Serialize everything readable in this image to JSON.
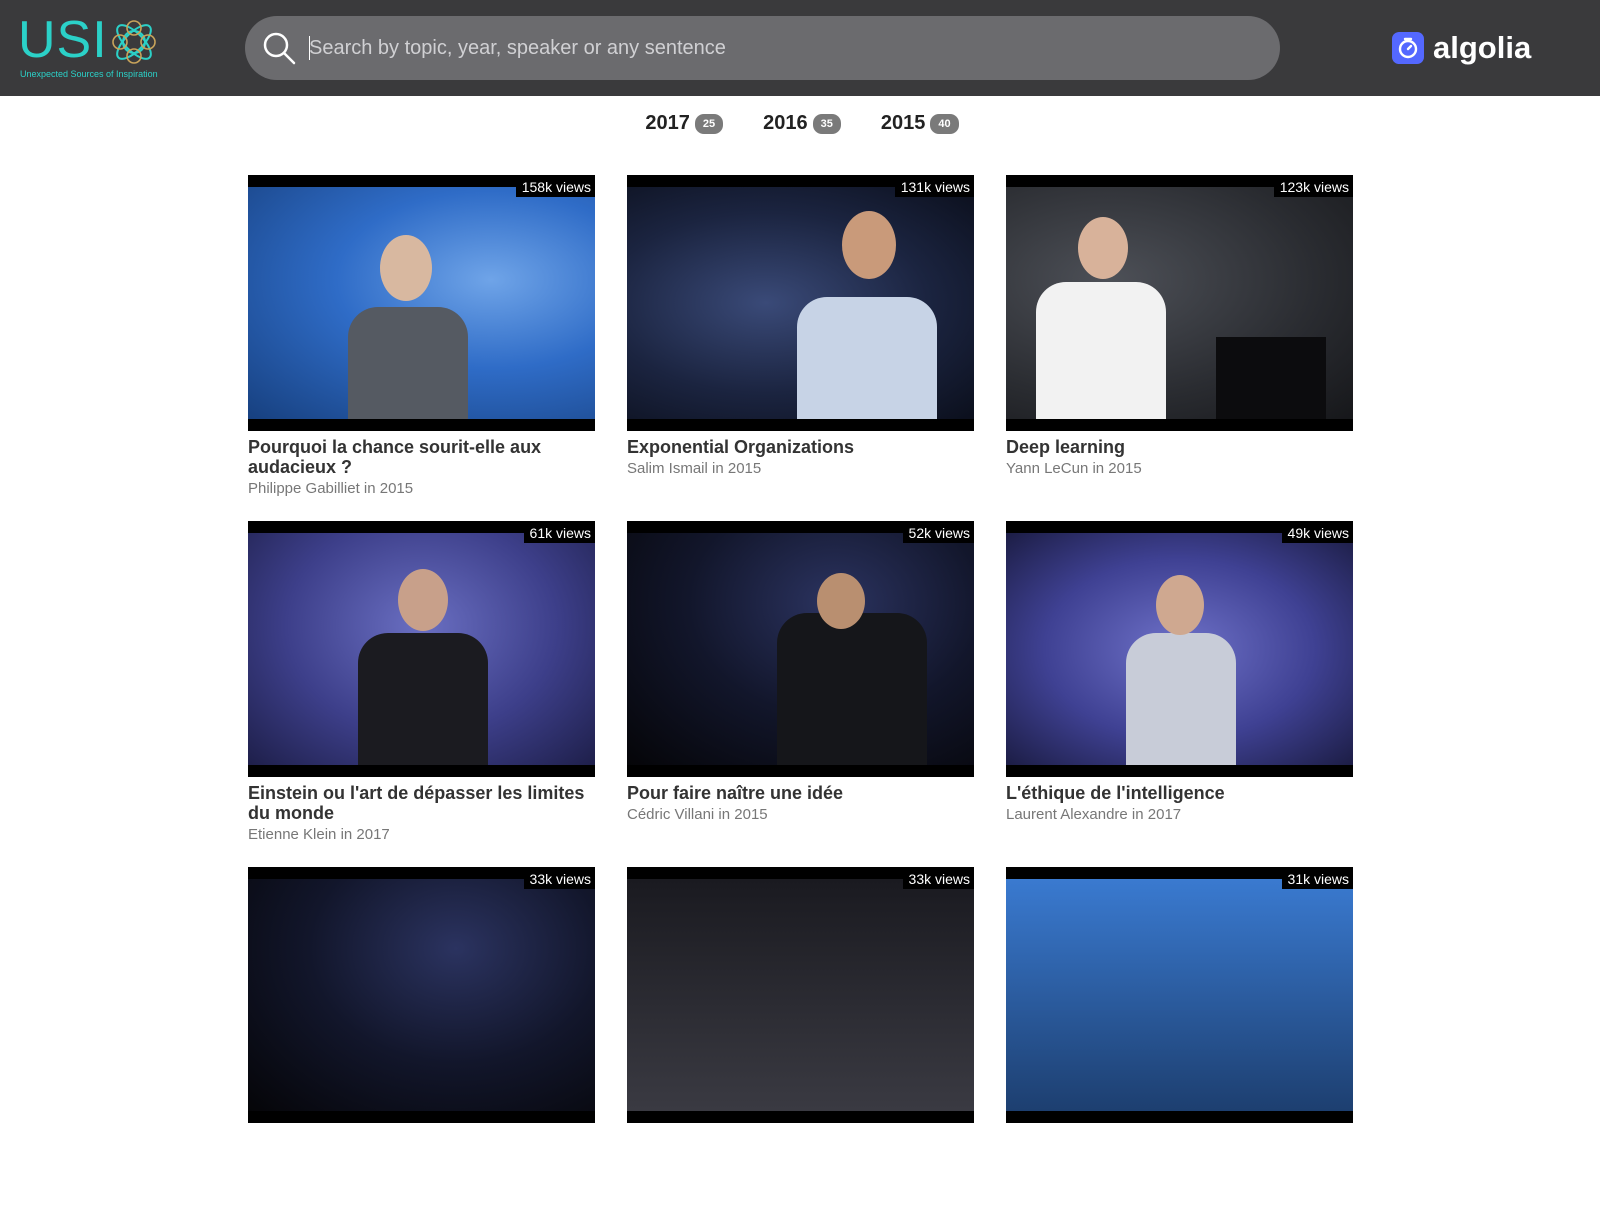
{
  "header": {
    "logo_text": "USI",
    "logo_tagline": "Unexpected Sources of Inspiration",
    "search_placeholder": "Search by topic, year, speaker or any sentence",
    "search_icon": "search-icon",
    "partner_logo": "algolia",
    "colors": {
      "bar": "#3a3a3c",
      "search": "#6b6b6e",
      "usi": "#2bd1c8",
      "algolia": "#5468ff"
    }
  },
  "years": [
    {
      "label": "2017",
      "count": "25"
    },
    {
      "label": "2016",
      "count": "35"
    },
    {
      "label": "2015",
      "count": "40"
    }
  ],
  "talks": [
    {
      "views": "158k views",
      "title": "Pourquoi la chance sourit-elle aux audacieux ?",
      "meta": "Philippe Gabilliet in 2015"
    },
    {
      "views": "131k views",
      "title": "Exponential Organizations",
      "meta": "Salim Ismail in 2015"
    },
    {
      "views": "123k views",
      "title": "Deep learning",
      "meta": "Yann LeCun in 2015"
    },
    {
      "views": "61k views",
      "title": "Einstein ou l'art de dépasser les limites du monde",
      "meta": "Etienne Klein in 2017"
    },
    {
      "views": "52k views",
      "title": "Pour faire naître une idée",
      "meta": "Cédric Villani in 2015"
    },
    {
      "views": "49k views",
      "title": "L'éthique de l'intelligence",
      "meta": "Laurent Alexandre in 2017"
    },
    {
      "views": "33k views",
      "title": "",
      "meta": ""
    },
    {
      "views": "33k views",
      "title": "",
      "meta": ""
    },
    {
      "views": "31k views",
      "title": "",
      "meta": ""
    }
  ]
}
